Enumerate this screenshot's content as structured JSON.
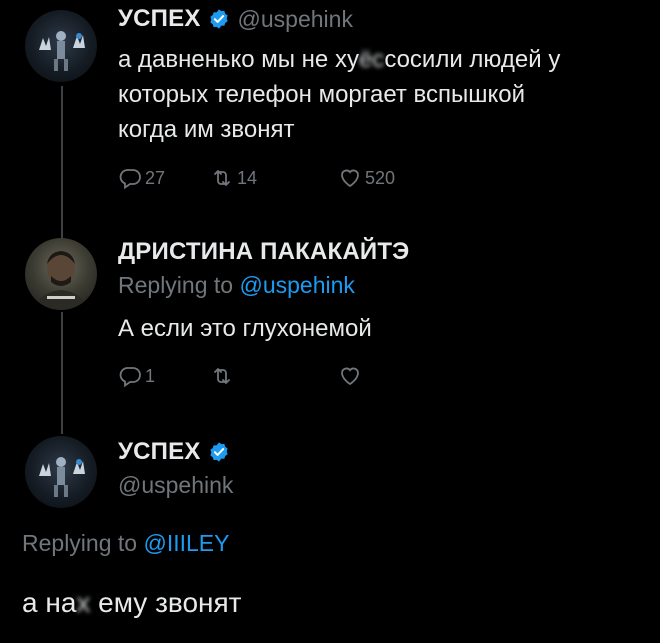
{
  "tweet1": {
    "name": "УСПЕХ",
    "handle": "@uspehink",
    "text_lines": [
      "а давненько мы не ху",
      "сосили людей у",
      "которых телефон моргает вспышкой",
      "когда им звонят"
    ],
    "censor_mark": "ёс",
    "replies": "27",
    "retweets": "14",
    "likes": "520"
  },
  "tweet2": {
    "name": "ДРИСТИНА ПАКАКАЙТЭ",
    "replying_prefix": "Replying to ",
    "replying_handle": "@uspehink",
    "text": "А если это глухонемой",
    "replies": "1",
    "retweets": "",
    "likes": ""
  },
  "tweet3": {
    "name": "УСПЕХ",
    "handle": "@uspehink",
    "replying_prefix": "Replying to ",
    "replying_handle": "@IIILEY",
    "text_prefix": "а на",
    "censor_mark": "х",
    "text_suffix": " ему звонят"
  },
  "colors": {
    "background": "#000000",
    "text": "#e7e9ea",
    "muted": "#71767b",
    "accent": "#1d9bf0",
    "thread_line": "#3e4144"
  }
}
